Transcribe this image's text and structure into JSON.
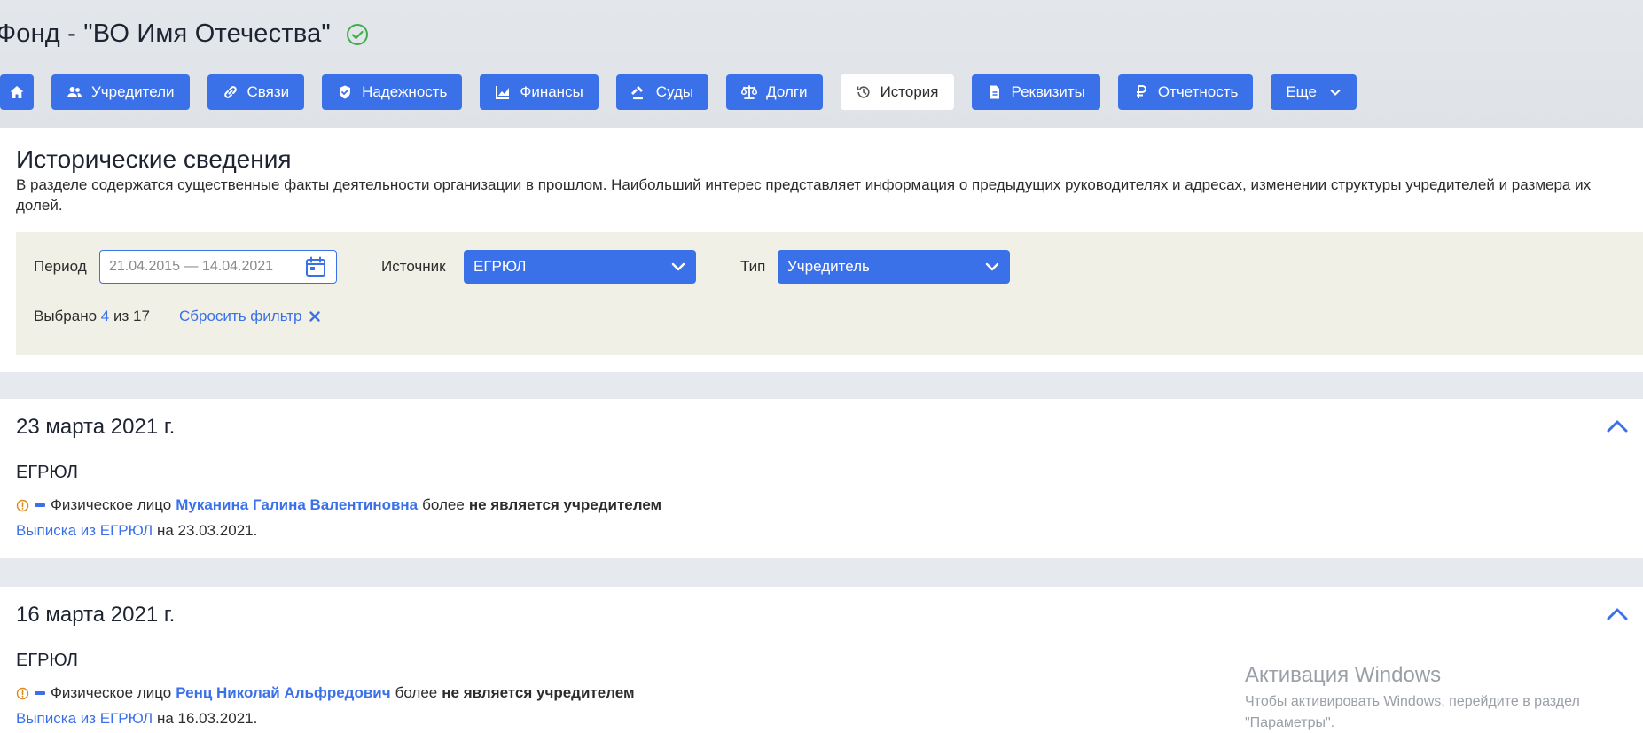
{
  "company": {
    "title": "Фонд - \"ВО Имя Отечества\"",
    "verified_icon": "check-circle-icon"
  },
  "tabs": [
    {
      "label": "",
      "icon": "home-icon"
    },
    {
      "label": "Учредители",
      "icon": "users-icon"
    },
    {
      "label": "Связи",
      "icon": "link-icon"
    },
    {
      "label": "Надежность",
      "icon": "shield-icon"
    },
    {
      "label": "Финансы",
      "icon": "chart-icon"
    },
    {
      "label": "Суды",
      "icon": "gavel-icon"
    },
    {
      "label": "Долги",
      "icon": "scales-icon"
    },
    {
      "label": "История",
      "icon": "history-icon",
      "active": true
    },
    {
      "label": "Реквизиты",
      "icon": "document-icon"
    },
    {
      "label": "Отчетность",
      "icon": "ruble-icon"
    },
    {
      "label": "Еще",
      "icon": "chevron-down-icon"
    }
  ],
  "section": {
    "title": "Исторические сведения",
    "description": "В разделе содержатся существенные факты деятельности организации в прошлом. Наибольший интерес представляет информация о предыдущих руководителях и адресах, изменении структуры учредителей и размера их долей."
  },
  "filters": {
    "period_label": "Период",
    "period_value": "21.04.2015 — 14.04.2021",
    "source_label": "Источник",
    "source_value": "ЕГРЮЛ",
    "type_label": "Тип",
    "type_value": "Учредитель",
    "selected_prefix": "Выбрано",
    "selected_count": "4",
    "selected_suffix": "из 17",
    "reset_label": "Сбросить фильтр"
  },
  "events": [
    {
      "date": "23 марта 2021 г.",
      "source": "ЕГРЮЛ",
      "prefix": "Физическое лицо",
      "person": "Муканина Галина Валентиновна",
      "middle": "более",
      "status": "не является учредителем",
      "extract_link": "Выписка из ЕГРЮЛ",
      "extract_suffix": "на 23.03.2021."
    },
    {
      "date": "16 марта 2021 г.",
      "source": "ЕГРЮЛ",
      "prefix": "Физическое лицо",
      "person": "Ренц Николай Альфредович",
      "middle": "более",
      "status": "не является учредителем",
      "extract_link": "Выписка из ЕГРЮЛ",
      "extract_suffix": "на 16.03.2021."
    }
  ],
  "watermark": {
    "title": "Активация Windows",
    "line1": "Чтобы активировать Windows, перейдите в раздел",
    "line2": "\"Параметры\"."
  },
  "colors": {
    "accent": "#3b71e8",
    "filter_bg": "#f1f0e6",
    "page_bg": "#e6e9ed",
    "verified": "#3fae4a",
    "warning": "#d98a1c"
  }
}
